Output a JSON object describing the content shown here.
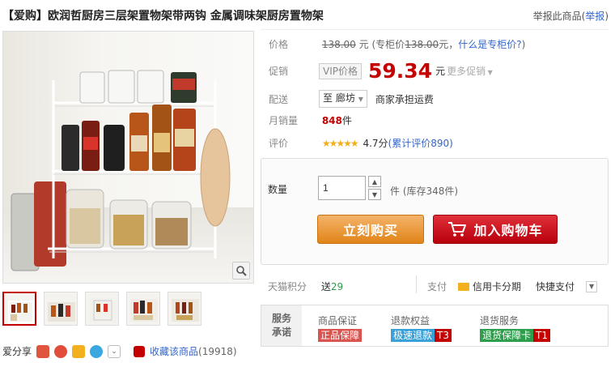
{
  "header": {
    "title": "【爱购】欧润哲厨房三层架置物架带两钩 金属调味架厨房置物架",
    "report_text": "举报此商品(",
    "report_link": "举报",
    "report_close": ")"
  },
  "price": {
    "label": "价格",
    "original": "138.00",
    "yuan": "元",
    "counter_prefix": "(专柜价",
    "counter_value": "138.00",
    "counter_suffix": "元，",
    "counter_link": "什么是专柜价?",
    "close": ")"
  },
  "promo": {
    "label": "促销",
    "vip": "VIP价格",
    "value": "59.34",
    "yuan": "元",
    "more": "更多促销"
  },
  "ship": {
    "label": "配送",
    "to": "至",
    "city": "廊坊",
    "note": "商家承担运费"
  },
  "monthly": {
    "label": "月销量",
    "value": "848",
    "unit": "件"
  },
  "rating": {
    "label": "评价",
    "stars": "★★★★★",
    "score": "4.7分",
    "link": "(累计评价890)"
  },
  "buy": {
    "qty_label": "数量",
    "qty_value": "1",
    "unit": "件",
    "stock": "(库存348件)",
    "buy_now": "立刻购买",
    "add_cart": "加入购物车"
  },
  "points": {
    "label": "天猫积分",
    "send": "送",
    "value": "29",
    "pay_label": "支付",
    "credit": "信用卡分期",
    "quick": "快捷支付"
  },
  "service": {
    "title_1": "服务",
    "title_2": "承诺",
    "cols": [
      {
        "head": "商品保证",
        "tag": "正品保障",
        "color": "#d9534f"
      },
      {
        "head": "退款权益",
        "tag": "极速退款",
        "badge": "T3",
        "color": "#3aa0d8"
      },
      {
        "head": "退货服务",
        "tag": "退货保障卡",
        "badge": "T1",
        "color": "#2e9e4c"
      }
    ]
  },
  "share": {
    "label": "爱分享",
    "fav": "收藏该商品",
    "fav_count": "(19918)"
  },
  "colors": {
    "accent": "#c40000",
    "link": "#3366cc",
    "buy_orange": "#e18418",
    "cart_red": "#c40000"
  }
}
